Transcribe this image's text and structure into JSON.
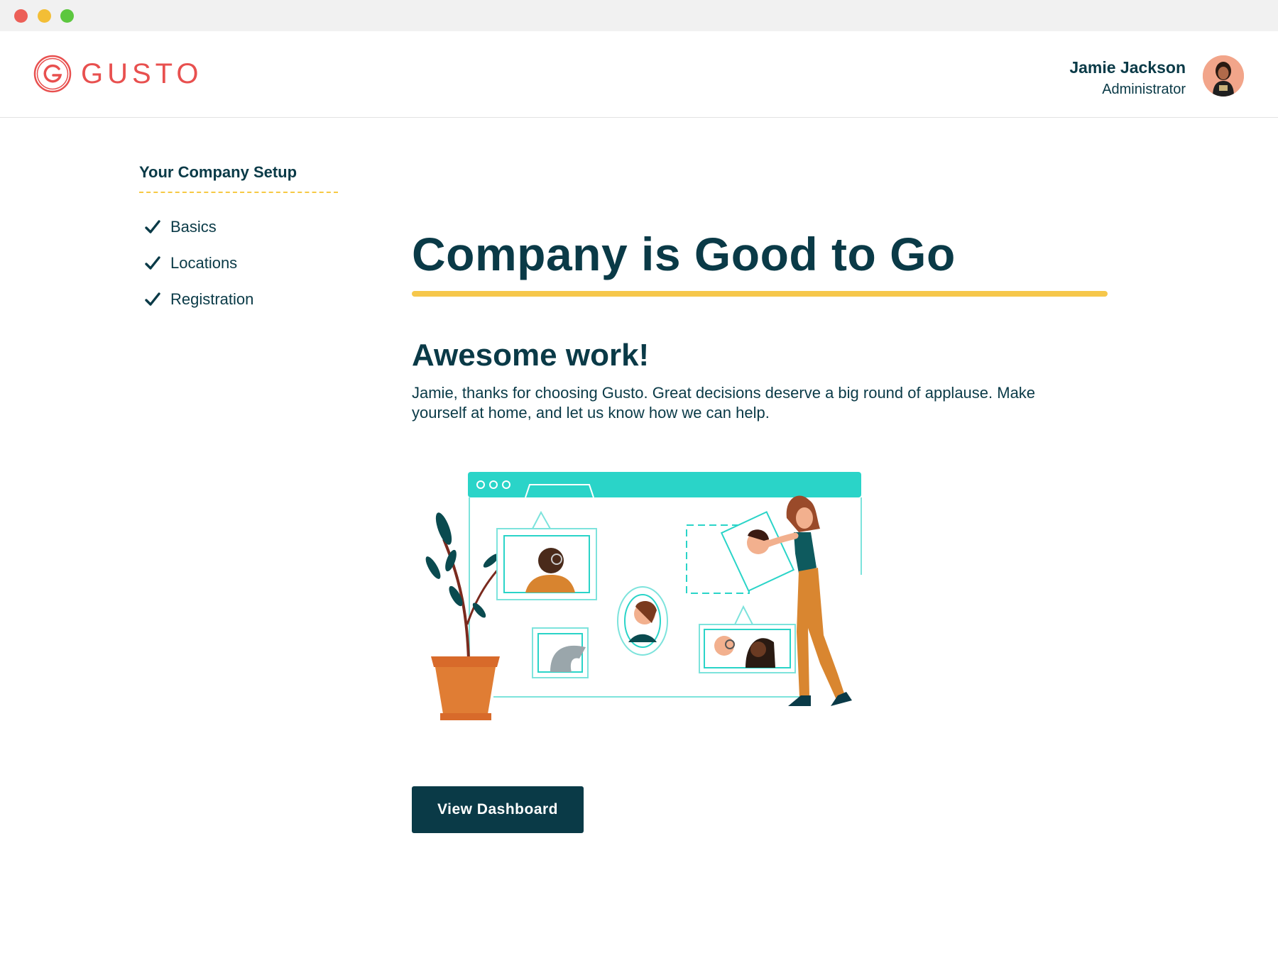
{
  "window": {
    "controls": [
      "close",
      "minimize",
      "maximize"
    ]
  },
  "header": {
    "logo_text": "GUSTO",
    "user_name": "Jamie Jackson",
    "user_role": "Administrator"
  },
  "sidebar": {
    "title": "Your Company Setup",
    "steps": [
      {
        "label": "Basics",
        "status": "complete"
      },
      {
        "label": "Locations",
        "status": "complete"
      },
      {
        "label": "Registration",
        "status": "complete"
      }
    ]
  },
  "main": {
    "headline": "Company is Good to Go",
    "subheadline": "Awesome work!",
    "message": "Jamie, thanks for choosing Gusto. Great decisions deserve a big round of applause. Make yourself at home, and let us know how we can help.",
    "cta_label": "View Dashboard"
  },
  "colors": {
    "brand_red": "#e8504f",
    "navy": "#0a3a47",
    "accent_yellow": "#f6c74b",
    "teal": "#2ad4c8"
  }
}
